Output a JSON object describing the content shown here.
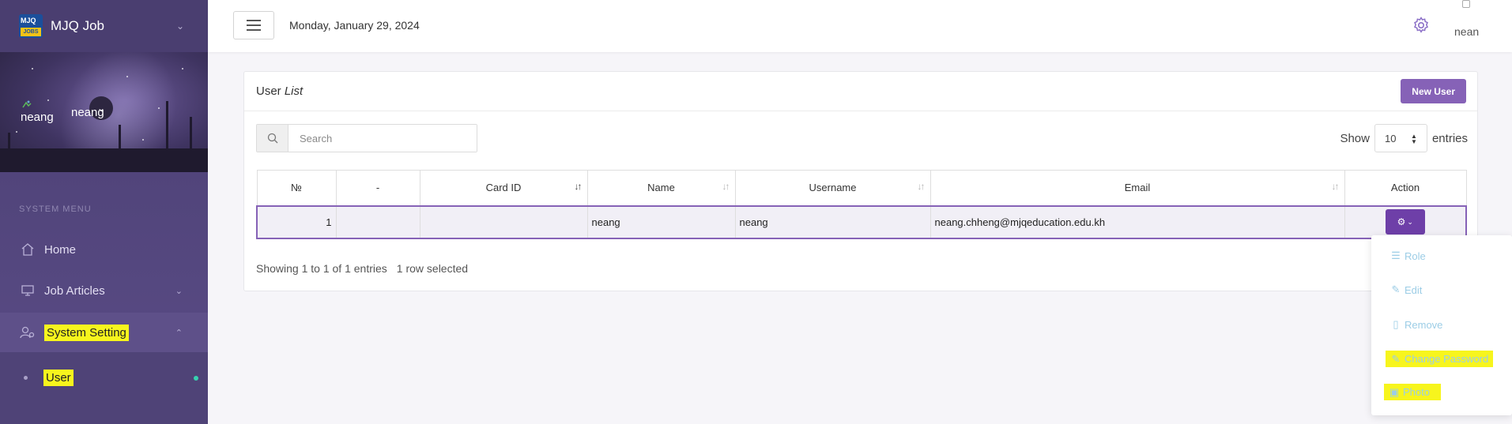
{
  "sidebar": {
    "brand": {
      "title": "MJQ Job",
      "logo_top": "MJQ",
      "logo_bottom": "JOBS"
    },
    "profile": {
      "avatar_alt": "neang",
      "name": "neang"
    },
    "menu_title": "SYSTEM MENU",
    "items": [
      {
        "label": "Home",
        "icon": "home-icon"
      },
      {
        "label": "Job Articles",
        "icon": "monitor-icon"
      },
      {
        "label": "System Setting",
        "icon": "users-gear-icon"
      }
    ],
    "submenu": [
      {
        "label": "User"
      }
    ]
  },
  "topbar": {
    "date": "Monday, January 29, 2024",
    "user": "nean"
  },
  "card": {
    "title_prefix": "User",
    "title_italic": "List",
    "new_button": "New User",
    "search_placeholder": "Search",
    "show_label": "Show",
    "page_length": "10",
    "entries_label": "entries",
    "columns": [
      "№",
      "-",
      "Card ID",
      "Name",
      "Username",
      "Email",
      "Action"
    ],
    "rows": [
      {
        "no": "1",
        "dash": "",
        "card_id": "",
        "name": "neang",
        "username": "neang",
        "email": "neang.chheng@mjqeducation.edu.kh"
      }
    ],
    "info": "Showing 1 to 1 of 1 entries",
    "selected": "1 row selected"
  },
  "dropdown": {
    "items": [
      {
        "label": "Role",
        "icon": "list-icon"
      },
      {
        "label": "Edit",
        "icon": "pencil-icon"
      },
      {
        "label": "Remove",
        "icon": "trash-icon"
      },
      {
        "label": "Change Password",
        "icon": "pencil-icon"
      },
      {
        "label": "Photo",
        "icon": "image-icon"
      }
    ]
  },
  "colors": {
    "accent": "#8662b7",
    "sidebar": "#4b3f73",
    "highlight": "#f7f51d",
    "link": "#8fc4e8"
  }
}
